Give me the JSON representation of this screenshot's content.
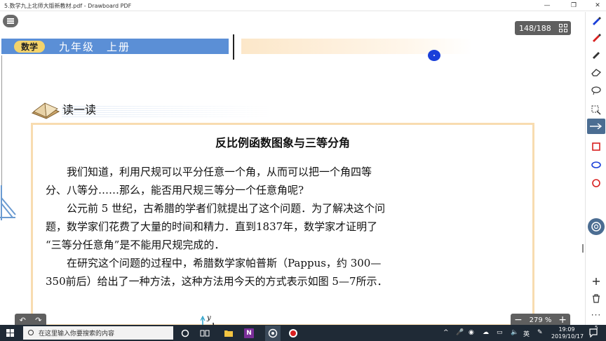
{
  "window": {
    "title": "5.数学九上北师大版新教材.pdf - Drawboard PDF",
    "minimize_glyph": "—",
    "maximize_glyph": "❐",
    "close_glyph": "✕"
  },
  "viewer": {
    "page_counter": "148/188",
    "zoom_label": "279 %",
    "zoom_minus": "−",
    "zoom_plus": "+",
    "undo_glyph": "↶",
    "redo_glyph": "↷"
  },
  "page": {
    "header_badge": "数学",
    "header_title": "九年级　上册",
    "section_title": "读一读",
    "article_title": "反比例函数图象与三等分角",
    "paragraphs": [
      "　　我们知道，利用尺规可以平分任意一个角，从而可以把一个角四等",
      "分、八等分……那么，能否用尺规三等分一个任意角呢?",
      "　　公元前 5 世纪，古希腊的学者们就提出了这个问题．为了解决这个问",
      "题，数学家们花费了大量的时间和精力．直到1837年，数学家才证明了",
      "“三等分任意角”是不能用尺规完成的．",
      "　　在研究这个问题的过程中，希腊数学家帕普斯（Pappus，约 300—",
      "350前后）给出了一种方法，这种方法用今天的方式表示如图 5—7所示．"
    ],
    "axis_label": "y"
  },
  "sidebar_tools": [
    {
      "name": "pen-icon",
      "color": "#1a3fd9"
    },
    {
      "name": "pen-icon",
      "color": "#d92020"
    },
    {
      "name": "pen-icon",
      "color": "#333333"
    },
    {
      "name": "eraser-icon",
      "color": "#333333"
    },
    {
      "name": "lasso-icon",
      "color": "#333333"
    },
    {
      "name": "select-icon",
      "color": "#333333"
    },
    {
      "name": "line-icon",
      "color": "#333333"
    },
    {
      "name": "arrow-icon",
      "color": "#333333"
    },
    {
      "name": "rectangle-icon",
      "color": "#d92020"
    },
    {
      "name": "ellipse-icon",
      "color": "#1a3fd9"
    },
    {
      "name": "circle-icon",
      "color": "#d92020"
    }
  ],
  "taskbar": {
    "search_placeholder": "在这里输入你要搜索的内容",
    "ime": "英",
    "time": "19:09",
    "date": "2019/10/17",
    "notifications": "5"
  }
}
